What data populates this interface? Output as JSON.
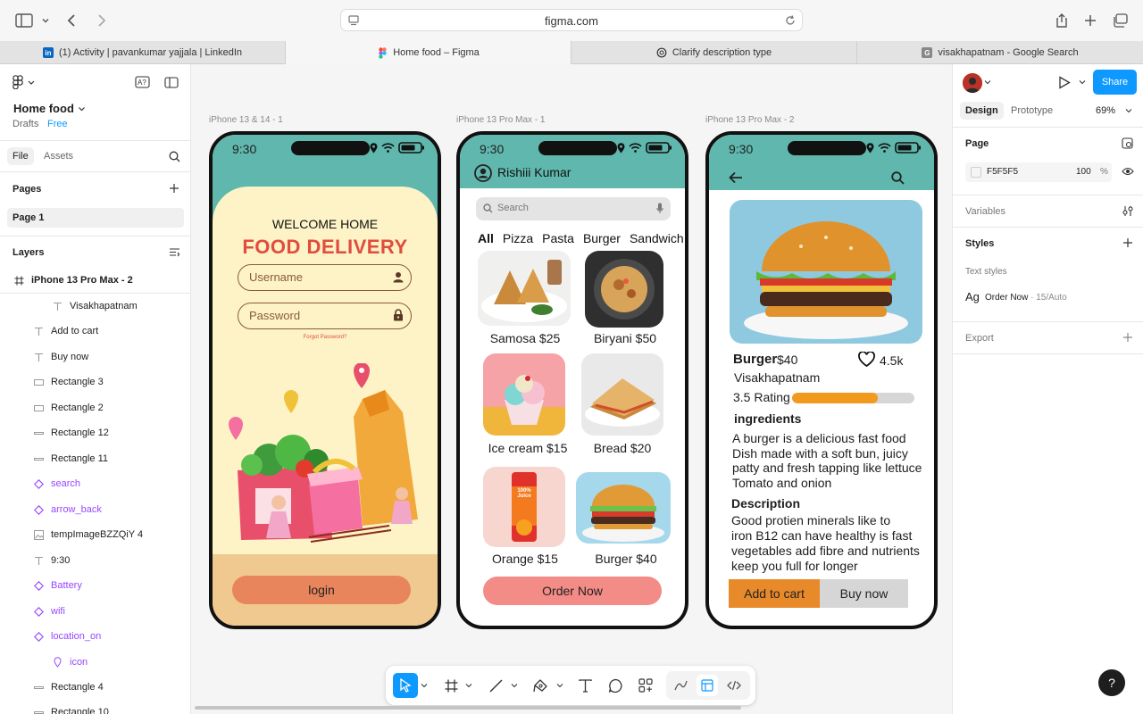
{
  "browser": {
    "url": "figma.com",
    "tabs": [
      {
        "label": "(1) Activity | pavankumar yajjala | LinkedIn",
        "icon": "in"
      },
      {
        "label": "Home food – Figma",
        "icon": "figma"
      },
      {
        "label": "Clarify description type",
        "icon": "chatgpt"
      },
      {
        "label": "visakhapatnam - Google Search",
        "icon": "G"
      }
    ]
  },
  "left_panel": {
    "file_name": "Home food",
    "drafts": "Drafts",
    "plan": "Free",
    "tab_file": "File",
    "tab_assets": "Assets",
    "pages_title": "Pages",
    "page_item": "Page 1",
    "layers_title": "Layers",
    "layers": [
      {
        "name": "iPhone 13 Pro Max - 2",
        "icon": "frame-icon"
      },
      {
        "name": "Visakhapatnam",
        "icon": "text-icon"
      },
      {
        "name": "Add to cart",
        "icon": "text-icon"
      },
      {
        "name": "Buy now",
        "icon": "text-icon"
      },
      {
        "name": "Rectangle 3",
        "icon": "rectangle-icon"
      },
      {
        "name": "Rectangle 2",
        "icon": "rectangle-icon"
      },
      {
        "name": "Rectangle 12",
        "icon": "line-icon"
      },
      {
        "name": "Rectangle 11",
        "icon": "line-icon"
      },
      {
        "name": "search",
        "icon": "component-icon"
      },
      {
        "name": "arrow_back",
        "icon": "component-icon"
      },
      {
        "name": "tempImageBZZQiY 4",
        "icon": "image-icon"
      },
      {
        "name": "9:30",
        "icon": "text-icon"
      },
      {
        "name": "Battery",
        "icon": "component-icon"
      },
      {
        "name": "wifi",
        "icon": "component-icon"
      },
      {
        "name": "location_on",
        "icon": "component-icon"
      },
      {
        "name": "icon",
        "icon": "pin-icon"
      },
      {
        "name": "Rectangle 4",
        "icon": "rectangle-icon"
      },
      {
        "name": "Rectangle 10",
        "icon": "rectangle-icon"
      }
    ]
  },
  "canvas": {
    "frames": [
      {
        "label": "iPhone 13 & 14 - 1"
      },
      {
        "label": "iPhone 13 Pro Max - 1"
      },
      {
        "label": "iPhone 13 Pro Max - 2"
      }
    ],
    "status_time": "9:30",
    "phone1": {
      "welcome": "WELCOME  HOME",
      "title": "FOOD DELIVERY",
      "username_placeholder": "Username",
      "password_placeholder": "Password",
      "forgot": "Forgot Password?",
      "login": "login"
    },
    "phone2": {
      "user_name": "Rishiii Kumar",
      "search_placeholder": "Search",
      "categories": [
        "All",
        "Pizza",
        "Pasta",
        "Burger",
        "Sandwich"
      ],
      "items": [
        {
          "label": "Samosa $25"
        },
        {
          "label": "Biryani $50"
        },
        {
          "label": "Ice cream $15"
        },
        {
          "label": "Bread $20"
        },
        {
          "label": "Orange $15"
        },
        {
          "label": "Burger $40"
        }
      ],
      "order_button": "Order Now",
      "orange_pack_text": "100% Juice"
    },
    "phone3": {
      "name": "Burger",
      "price": "$40",
      "likes": "4.5k",
      "location": "Visakhapatnam",
      "rating": "3.5 Rating",
      "rating_fraction": 0.7,
      "ingredients_title": "ingredients",
      "ingredients_lines": [
        "A burger is a delicious fast food",
        "Dish made with a soft bun, juicy",
        "patty and fresh tapping like lettuce",
        "Tomato and onion"
      ],
      "description_title": "Description",
      "description_lines": [
        "Good  protien  minerals  like  to",
        "iron B12 can have healthy  is fast",
        "vegetables add fibre and nutrients",
        "keep you full for longer"
      ],
      "add_to_cart": "Add to cart",
      "buy_now": "Buy now"
    }
  },
  "right_panel": {
    "share": "Share",
    "tab_design": "Design",
    "tab_prototype": "Prototype",
    "zoom": "69%",
    "page_title": "Page",
    "page_color": "F5F5F5",
    "page_opacity": "100",
    "percent_sign": "%",
    "variables_title": "Variables",
    "styles_title": "Styles",
    "text_styles_title": "Text styles",
    "text_style_ag": "Ag",
    "text_style_name": "Order Now",
    "text_style_meta": " · 15/Auto",
    "export_title": "Export",
    "help": "?"
  },
  "colors": {
    "teal": "#5fb7ad",
    "login_bg": "#efc98f",
    "login_btn": "#e8855c",
    "order_btn": "#f38b86",
    "add_cart": "#e8892a",
    "buy_now": "#d6d6d6",
    "rating_fill": "#f29a1d",
    "figma_blue": "#0d99ff",
    "title_red": "#e14c3f"
  }
}
